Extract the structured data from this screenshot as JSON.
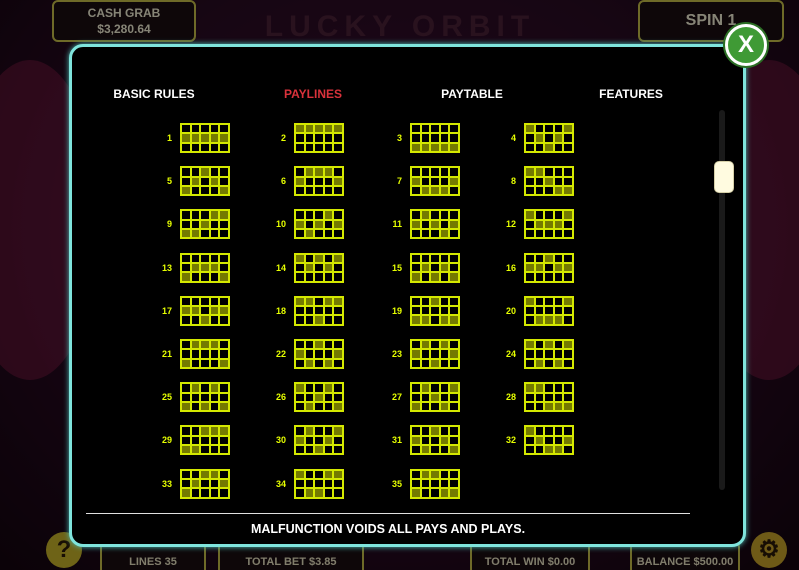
{
  "game": {
    "title": "LUCKY ORBIT",
    "cash_grab_label": "CASH GRAB",
    "cash_grab_value": "$3,280.64",
    "spin_label": "SPIN 1",
    "lines_label": "LINES",
    "lines_value": "35",
    "total_bet_label": "TOTAL BET",
    "total_bet_value": "$3.85",
    "total_win_label": "TOTAL WIN",
    "total_win_value": "$0.00",
    "balance_label": "BALANCE",
    "balance_value": "$500.00",
    "help_icon": "?",
    "settings_icon": "gear-icon"
  },
  "modal": {
    "close_label": "X",
    "tabs": [
      {
        "label": "BASIC RULES",
        "active": false
      },
      {
        "label": "PAYLINES",
        "active": true
      },
      {
        "label": "PAYTABLE",
        "active": false
      },
      {
        "label": "FEATURES",
        "active": false
      }
    ],
    "footer": "MALFUNCTION VOIDS ALL PAYS AND PLAYS.",
    "paylines": [
      {
        "num": "1",
        "rows": [
          1,
          1,
          1,
          1,
          1
        ]
      },
      {
        "num": "2",
        "rows": [
          0,
          0,
          0,
          0,
          0
        ]
      },
      {
        "num": "3",
        "rows": [
          2,
          2,
          2,
          2,
          2
        ]
      },
      {
        "num": "4",
        "rows": [
          0,
          1,
          2,
          1,
          0
        ]
      },
      {
        "num": "5",
        "rows": [
          2,
          1,
          0,
          1,
          2
        ]
      },
      {
        "num": "6",
        "rows": [
          1,
          0,
          0,
          0,
          1
        ]
      },
      {
        "num": "7",
        "rows": [
          1,
          2,
          2,
          2,
          1
        ]
      },
      {
        "num": "8",
        "rows": [
          0,
          0,
          1,
          2,
          2
        ]
      },
      {
        "num": "9",
        "rows": [
          2,
          2,
          1,
          0,
          0
        ]
      },
      {
        "num": "10",
        "rows": [
          1,
          2,
          1,
          0,
          1
        ]
      },
      {
        "num": "11",
        "rows": [
          1,
          0,
          1,
          2,
          1
        ]
      },
      {
        "num": "12",
        "rows": [
          0,
          1,
          1,
          1,
          0
        ]
      },
      {
        "num": "13",
        "rows": [
          2,
          1,
          1,
          1,
          2
        ]
      },
      {
        "num": "14",
        "rows": [
          0,
          1,
          0,
          1,
          0
        ]
      },
      {
        "num": "15",
        "rows": [
          2,
          1,
          2,
          1,
          2
        ]
      },
      {
        "num": "16",
        "rows": [
          1,
          1,
          0,
          1,
          1
        ]
      },
      {
        "num": "17",
        "rows": [
          1,
          1,
          2,
          1,
          1
        ]
      },
      {
        "num": "18",
        "rows": [
          0,
          0,
          2,
          0,
          0
        ]
      },
      {
        "num": "19",
        "rows": [
          2,
          2,
          0,
          2,
          2
        ]
      },
      {
        "num": "20",
        "rows": [
          0,
          2,
          2,
          2,
          0
        ]
      },
      {
        "num": "21",
        "rows": [
          2,
          0,
          0,
          0,
          2
        ]
      },
      {
        "num": "22",
        "rows": [
          1,
          2,
          0,
          2,
          1
        ]
      },
      {
        "num": "23",
        "rows": [
          1,
          0,
          2,
          0,
          1
        ]
      },
      {
        "num": "24",
        "rows": [
          0,
          2,
          0,
          2,
          0
        ]
      },
      {
        "num": "25",
        "rows": [
          2,
          0,
          2,
          0,
          2
        ]
      },
      {
        "num": "26",
        "rows": [
          0,
          2,
          1,
          0,
          2
        ]
      },
      {
        "num": "27",
        "rows": [
          2,
          0,
          1,
          2,
          0
        ]
      },
      {
        "num": "28",
        "rows": [
          0,
          0,
          2,
          2,
          2
        ]
      },
      {
        "num": "29",
        "rows": [
          2,
          2,
          0,
          0,
          0
        ]
      },
      {
        "num": "30",
        "rows": [
          1,
          0,
          2,
          1,
          0
        ]
      },
      {
        "num": "31",
        "rows": [
          1,
          2,
          0,
          1,
          2
        ]
      },
      {
        "num": "32",
        "rows": [
          0,
          1,
          2,
          2,
          1
        ]
      },
      {
        "num": "33",
        "rows": [
          2,
          1,
          0,
          0,
          1
        ]
      },
      {
        "num": "34",
        "rows": [
          0,
          2,
          2,
          0,
          0
        ]
      },
      {
        "num": "35",
        "rows": [
          2,
          0,
          0,
          2,
          2
        ]
      }
    ]
  },
  "colors": {
    "accent_cyan": "#7fe4dc",
    "active_tab": "#d9323b",
    "payline_yellow": "#d4e800",
    "payline_fill": "#747a00",
    "close_green": "#3f9a35"
  }
}
